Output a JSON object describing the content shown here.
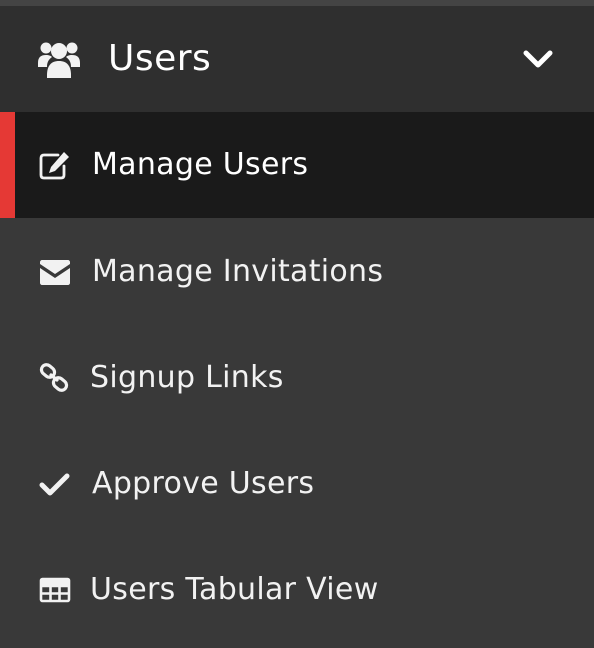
{
  "colors": {
    "background": "#393939",
    "header_background": "#2f2f2f",
    "active_background": "#1a1a1a",
    "accent": "#e53935",
    "text": "#f2f2f2"
  },
  "group": {
    "title": "Users",
    "icon": "users-icon",
    "expand_icon": "chevron-down-icon",
    "expanded": true
  },
  "menu": {
    "active_index": 0,
    "items": [
      {
        "label": "Manage Users",
        "icon": "edit-icon"
      },
      {
        "label": "Manage Invitations",
        "icon": "envelope-icon"
      },
      {
        "label": "Signup Links",
        "icon": "link-icon"
      },
      {
        "label": "Approve Users",
        "icon": "check-icon"
      },
      {
        "label": "Users Tabular View",
        "icon": "table-icon"
      }
    ]
  }
}
